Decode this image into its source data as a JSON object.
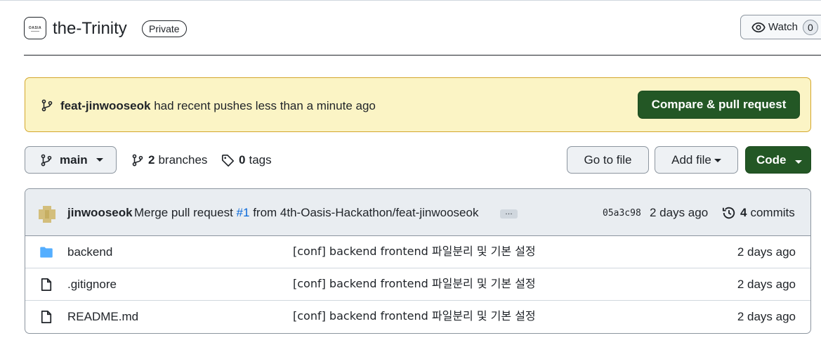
{
  "repo": {
    "name": "the-Trinity",
    "visibility": "Private",
    "avatar_text": "OASIA"
  },
  "watch": {
    "label": "Watch",
    "count": "0"
  },
  "flash": {
    "branch": "feat-jinwooseok",
    "message": "had recent pushes less than a minute ago",
    "button": "Compare & pull request"
  },
  "toolbar": {
    "branch": "main",
    "branches_count": "2",
    "branches_label": "branches",
    "tags_count": "0",
    "tags_label": "tags",
    "goto_file": "Go to file",
    "add_file": "Add file",
    "code": "Code"
  },
  "commit": {
    "author": "jinwooseok",
    "message_prefix": "Merge pull request",
    "pr_number": "#1",
    "message_suffix": "from 4th-Oasis-Hackathon/feat-jinwooseok",
    "ellipsis": "…",
    "sha": "05a3c98",
    "age": "2 days ago",
    "commits_count": "4",
    "commits_label": "commits"
  },
  "files": [
    {
      "name": "backend",
      "type": "folder",
      "message": "[conf] backend frontend 파일분리 및 기본 설정",
      "age": "2 days ago"
    },
    {
      "name": ".gitignore",
      "type": "file",
      "message": "[conf] backend frontend 파일분리 및 기본 설정",
      "age": "2 days ago"
    },
    {
      "name": "README.md",
      "type": "file",
      "message": "[conf] backend frontend 파일분리 및 기본 설정",
      "age": "2 days ago"
    }
  ],
  "colors": {
    "primary_green": "#235725",
    "flash_bg": "#fbf4c5",
    "folder_blue": "#54aeff",
    "link_blue": "#0969da"
  }
}
